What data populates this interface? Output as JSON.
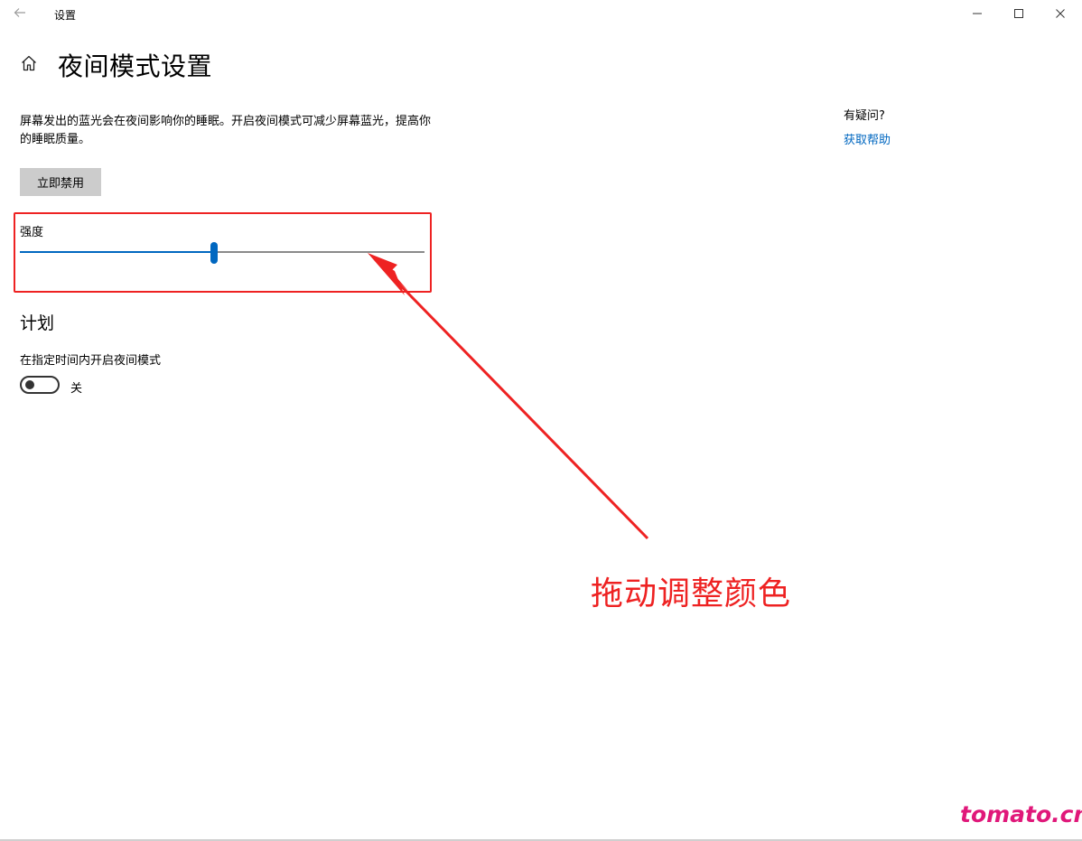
{
  "window": {
    "title": "设置"
  },
  "header": {
    "page_title": "夜间模式设置"
  },
  "main": {
    "description": "屏幕发出的蓝光会在夜间影响你的睡眠。开启夜间模式可减少屏幕蓝光，提高你的睡眠质量。",
    "disable_button_label": "立即禁用",
    "strength": {
      "label": "强度",
      "value_percent": 48
    },
    "schedule": {
      "heading": "计划",
      "toggle_label": "在指定时间内开启夜间模式",
      "toggle_state_text": "关",
      "toggle_on": false
    }
  },
  "help": {
    "question": "有疑问?",
    "link_label": "获取帮助"
  },
  "annotation": {
    "text": "拖动调整颜色",
    "color": "#ee2222"
  },
  "watermark": "tomato.cm",
  "colors": {
    "accent": "#0067c0",
    "annotation": "#ee2222",
    "watermark": "#e0187a"
  },
  "icons": {
    "back": "back-arrow-icon",
    "home": "home-icon",
    "minimize": "minimize-icon",
    "maximize": "maximize-icon",
    "close": "close-icon"
  }
}
